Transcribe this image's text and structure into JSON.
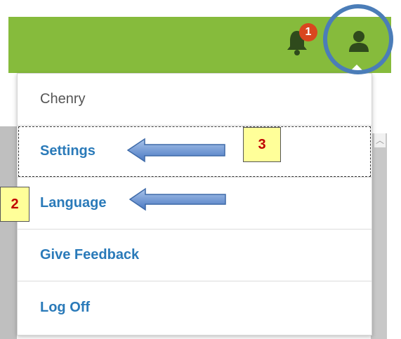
{
  "header": {
    "notification_count": "1",
    "bell_icon": "bell-icon",
    "user_icon": "user-icon",
    "accent_color": "#86bb3c"
  },
  "user_menu": {
    "username": "Chenry",
    "items": [
      {
        "label": "Settings"
      },
      {
        "label": "Language"
      },
      {
        "label": "Give Feedback"
      },
      {
        "label": "Log Off"
      }
    ]
  },
  "annotations": {
    "callout_settings": "3",
    "callout_language": "2"
  }
}
